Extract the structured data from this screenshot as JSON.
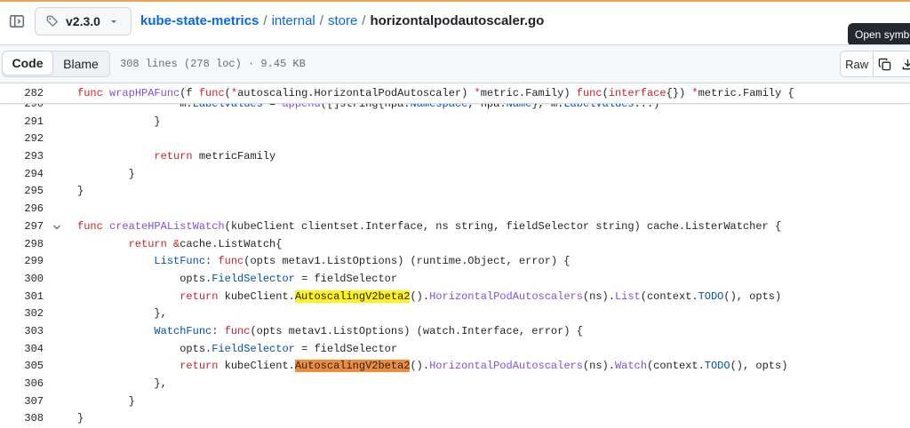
{
  "branch": {
    "label": "v2.3.0"
  },
  "breadcrumb": {
    "repo": "kube-state-metrics",
    "sep": "/",
    "dir1": "internal",
    "dir2": "store",
    "file": "horizontalpodautoscaler.go"
  },
  "tooltip": {
    "text": "Open symbols panel"
  },
  "toolbar": {
    "code_tab": "Code",
    "blame_tab": "Blame",
    "file_info": "308 lines (278 loc) · 9.45 KB",
    "raw_button": "Raw"
  },
  "colors": {
    "keyword": "#cf222e",
    "function": "#8250df",
    "constant": "#0550ae",
    "highlight_yellow": "#fff11c",
    "highlight_orange": "#f08c3a"
  },
  "sticky_line": {
    "number": "282",
    "tokens": [
      {
        "t": "func",
        "c": "k"
      },
      {
        "t": " "
      },
      {
        "t": "wrapHPAFunc",
        "c": "f"
      },
      {
        "t": "(f "
      },
      {
        "t": "func",
        "c": "k"
      },
      {
        "t": "("
      },
      {
        "t": "*",
        "c": "k"
      },
      {
        "t": "autoscaling.HorizontalPodAutoscaler) "
      },
      {
        "t": "*",
        "c": "k"
      },
      {
        "t": "metric.Family) "
      },
      {
        "t": "func",
        "c": "k"
      },
      {
        "t": "("
      },
      {
        "t": "interface",
        "c": "k"
      },
      {
        "t": "{}) "
      },
      {
        "t": "*",
        "c": "k"
      },
      {
        "t": "metric.Family {"
      }
    ]
  },
  "code_lines": [
    {
      "number": "290",
      "fold": false,
      "tokens": [
        {
          "t": "                m."
        },
        {
          "t": "LabelValues",
          "c": "c"
        },
        {
          "t": " = "
        },
        {
          "t": "append",
          "c": "f"
        },
        {
          "t": "([]string{hpa."
        },
        {
          "t": "Namespace",
          "c": "c"
        },
        {
          "t": ", hpa."
        },
        {
          "t": "Name",
          "c": "c"
        },
        {
          "t": "}, m."
        },
        {
          "t": "LabelValues",
          "c": "c"
        },
        {
          "t": "...)"
        }
      ]
    },
    {
      "number": "291",
      "fold": false,
      "tokens": [
        {
          "t": "            }"
        }
      ]
    },
    {
      "number": "292",
      "fold": false,
      "tokens": [
        {
          "t": ""
        }
      ]
    },
    {
      "number": "293",
      "fold": false,
      "tokens": [
        {
          "t": "            "
        },
        {
          "t": "return",
          "c": "k"
        },
        {
          "t": " metricFamily"
        }
      ]
    },
    {
      "number": "294",
      "fold": false,
      "tokens": [
        {
          "t": "        }"
        }
      ]
    },
    {
      "number": "295",
      "fold": false,
      "tokens": [
        {
          "t": "}"
        }
      ]
    },
    {
      "number": "296",
      "fold": false,
      "tokens": [
        {
          "t": ""
        }
      ]
    },
    {
      "number": "297",
      "fold": true,
      "tokens": [
        {
          "t": "func",
          "c": "k"
        },
        {
          "t": " "
        },
        {
          "t": "createHPAListWatch",
          "c": "f"
        },
        {
          "t": "(kubeClient clientset.Interface, ns string, fieldSelector string) cache.ListerWatcher {"
        }
      ]
    },
    {
      "number": "298",
      "fold": false,
      "tokens": [
        {
          "t": "        "
        },
        {
          "t": "return",
          "c": "k"
        },
        {
          "t": " "
        },
        {
          "t": "&",
          "c": "k"
        },
        {
          "t": "cache.ListWatch{"
        }
      ]
    },
    {
      "number": "299",
      "fold": false,
      "tokens": [
        {
          "t": "            "
        },
        {
          "t": "ListFunc",
          "c": "c"
        },
        {
          "t": ": "
        },
        {
          "t": "func",
          "c": "k"
        },
        {
          "t": "(opts metav1.ListOptions) (runtime.Object, error) {"
        }
      ]
    },
    {
      "number": "300",
      "fold": false,
      "tokens": [
        {
          "t": "                opts."
        },
        {
          "t": "FieldSelector",
          "c": "c"
        },
        {
          "t": " = fieldSelector"
        }
      ]
    },
    {
      "number": "301",
      "fold": false,
      "tokens": [
        {
          "t": "                "
        },
        {
          "t": "return",
          "c": "k"
        },
        {
          "t": " kubeClient."
        },
        {
          "t": "AutoscalingV2beta2",
          "c": "hl-y"
        },
        {
          "t": "()."
        },
        {
          "t": "HorizontalPodAutoscalers",
          "c": "f"
        },
        {
          "t": "(ns)."
        },
        {
          "t": "List",
          "c": "f"
        },
        {
          "t": "(context."
        },
        {
          "t": "TODO",
          "c": "c"
        },
        {
          "t": "(), opts)"
        }
      ]
    },
    {
      "number": "302",
      "fold": false,
      "tokens": [
        {
          "t": "            },"
        }
      ]
    },
    {
      "number": "303",
      "fold": false,
      "tokens": [
        {
          "t": "            "
        },
        {
          "t": "WatchFunc",
          "c": "c"
        },
        {
          "t": ": "
        },
        {
          "t": "func",
          "c": "k"
        },
        {
          "t": "(opts metav1.ListOptions) (watch.Interface, error) {"
        }
      ]
    },
    {
      "number": "304",
      "fold": false,
      "tokens": [
        {
          "t": "                opts."
        },
        {
          "t": "FieldSelector",
          "c": "c"
        },
        {
          "t": " = fieldSelector"
        }
      ]
    },
    {
      "number": "305",
      "fold": false,
      "tokens": [
        {
          "t": "                "
        },
        {
          "t": "return",
          "c": "k"
        },
        {
          "t": " kubeClient."
        },
        {
          "t": "AutoscalingV2beta2",
          "c": "hl-o"
        },
        {
          "t": "()."
        },
        {
          "t": "HorizontalPodAutoscalers",
          "c": "f"
        },
        {
          "t": "(ns)."
        },
        {
          "t": "Watch",
          "c": "f"
        },
        {
          "t": "(context."
        },
        {
          "t": "TODO",
          "c": "c"
        },
        {
          "t": "(), opts)"
        }
      ]
    },
    {
      "number": "306",
      "fold": false,
      "tokens": [
        {
          "t": "            },"
        }
      ]
    },
    {
      "number": "307",
      "fold": false,
      "tokens": [
        {
          "t": "        }"
        }
      ]
    },
    {
      "number": "308",
      "fold": false,
      "tokens": [
        {
          "t": "}"
        }
      ]
    }
  ]
}
